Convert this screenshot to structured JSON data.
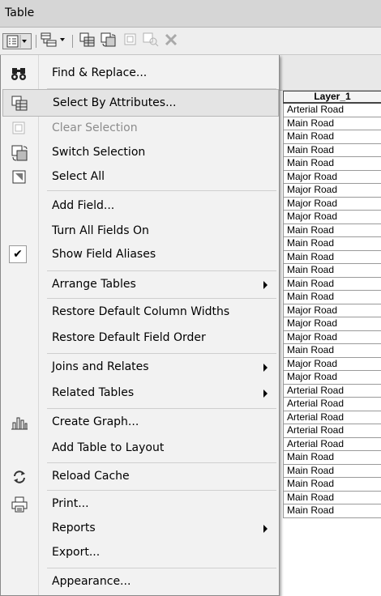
{
  "window": {
    "title": "Table"
  },
  "toolbar": {
    "buttons": [
      {
        "name": "table-options-icon"
      },
      {
        "name": "related-tables-icon"
      },
      {
        "name": "select-by-attributes-icon"
      },
      {
        "name": "switch-selection-icon"
      },
      {
        "name": "clear-selection-icon"
      },
      {
        "name": "zoom-selected-icon"
      },
      {
        "name": "delete-selected-icon"
      }
    ]
  },
  "table": {
    "header": "Layer_1",
    "rows": [
      "Arterial Road",
      "Main Road",
      "Main Road",
      "Main Road",
      "Main Road",
      "Major Road",
      "Major Road",
      "Major Road",
      "Major Road",
      "Main Road",
      "Main Road",
      "Main Road",
      "Main Road",
      "Main Road",
      "Main Road",
      "Major Road",
      "Major Road",
      "Major Road",
      "Main Road",
      "Major Road",
      "Major Road",
      "Arterial Road",
      "Arterial Road",
      "Arterial Road",
      "Arterial Road",
      "Arterial Road",
      "Main Road",
      "Main Road",
      "Main Road",
      "Main Road",
      "Main Road"
    ]
  },
  "menu": {
    "find_replace": "Find & Replace...",
    "select_by_attributes": "Select By Attributes...",
    "clear_selection": "Clear Selection",
    "switch_selection": "Switch Selection",
    "select_all": "Select All",
    "add_field": "Add Field...",
    "turn_all_fields_on": "Turn All Fields On",
    "show_field_aliases": "Show Field Aliases",
    "arrange_tables": "Arrange Tables",
    "restore_column_widths": "Restore Default Column Widths",
    "restore_field_order": "Restore Default Field Order",
    "joins_relates": "Joins and Relates",
    "related_tables": "Related Tables",
    "create_graph": "Create Graph...",
    "add_table_to_layout": "Add Table to Layout",
    "reload_cache": "Reload Cache",
    "print": "Print...",
    "reports": "Reports",
    "export": "Export...",
    "appearance": "Appearance..."
  }
}
